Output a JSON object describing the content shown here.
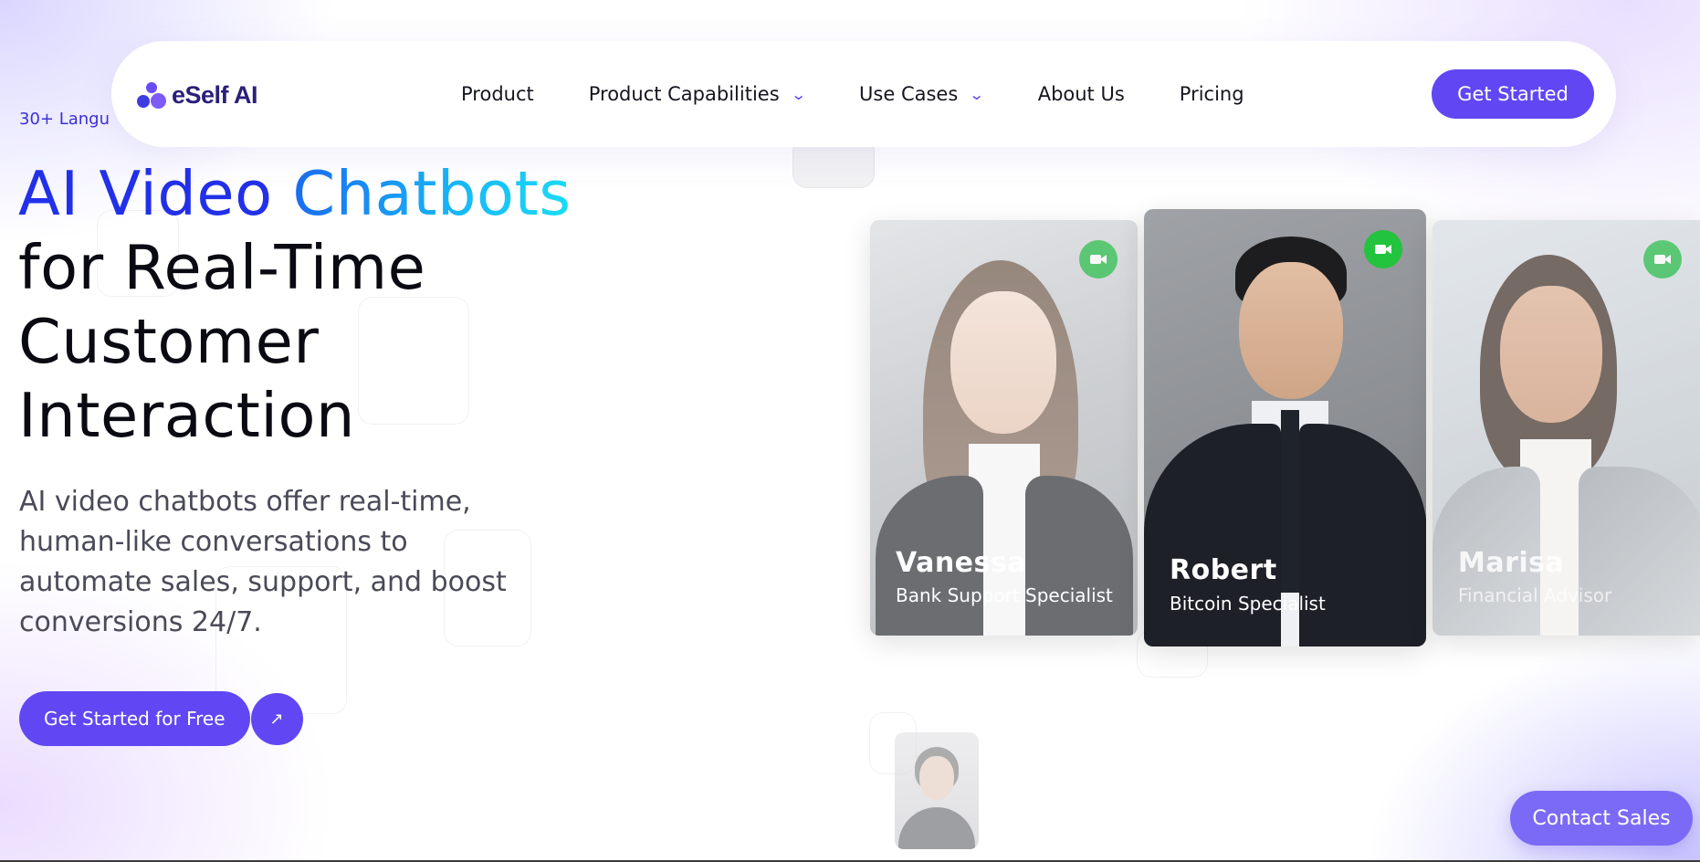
{
  "nav": {
    "logo_text": "eSelf AI",
    "items": [
      {
        "label": "Product",
        "has_dropdown": false
      },
      {
        "label": "Product Capabilities",
        "has_dropdown": true
      },
      {
        "label": "Use Cases",
        "has_dropdown": true
      },
      {
        "label": "About Us",
        "has_dropdown": false
      },
      {
        "label": "Pricing",
        "has_dropdown": false
      }
    ],
    "cta_label": "Get Started"
  },
  "hero": {
    "badge": "30+ Langu",
    "title_line1_a": "AI Video",
    "title_line1_b": "Chatbots",
    "title_line2": "for Real-Time",
    "title_line3": "Customer",
    "title_line4": "Interaction",
    "description": "AI video chatbots offer real-time, human-like conversations to automate sales, support, and boost conversions 24/7.",
    "cta_label": "Get Started for Free",
    "cta_arrow": "↗"
  },
  "cards": [
    {
      "name": "Vanessa",
      "role": "Bank Support Specialist"
    },
    {
      "name": "Robert",
      "role": "Bitcoin Specialist"
    },
    {
      "name": "Marisa",
      "role": "Financial Advisor"
    }
  ],
  "contact_sales_label": "Contact Sales",
  "icons": {
    "dropdown": "chevron-down-icon",
    "camera": "video-camera-icon",
    "arrow": "arrow-up-right-icon"
  },
  "colors": {
    "primary": "#6147f3",
    "title_blue": "#2230e8",
    "camera_green": "#3cc25a"
  }
}
